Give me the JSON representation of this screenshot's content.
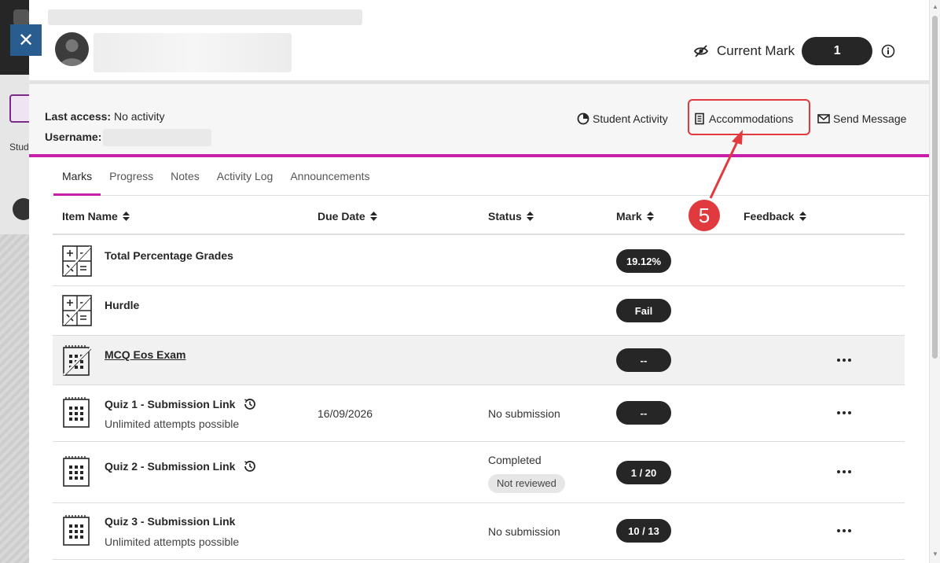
{
  "background": {
    "student_abbrev": "Stud"
  },
  "header": {
    "current_mark_label": "Current Mark",
    "current_mark_value": "1"
  },
  "meta": {
    "last_access_label": "Last access:",
    "last_access_value": "No activity",
    "username_label": "Username:"
  },
  "actions": {
    "student_activity": "Student Activity",
    "accommodations": "Accommodations",
    "send_message": "Send Message"
  },
  "tabs": [
    "Marks",
    "Progress",
    "Notes",
    "Activity Log",
    "Announcements"
  ],
  "columns": {
    "item_name": "Item Name",
    "due_date": "Due Date",
    "status": "Status",
    "mark": "Mark",
    "feedback": "Feedback"
  },
  "rows": [
    {
      "name": "Total Percentage Grades",
      "mark": "19.12%"
    },
    {
      "name": "Hurdle",
      "mark": "Fail"
    },
    {
      "name": "MCQ Eos Exam",
      "mark": "--"
    },
    {
      "name": "Quiz 1 - Submission Link",
      "sub": "Unlimited attempts possible",
      "due": "16/09/2026",
      "status": "No submission",
      "mark": "--"
    },
    {
      "name": "Quiz 2 - Submission Link",
      "status": "Completed",
      "status_badge": "Not reviewed",
      "mark": "1 / 20"
    },
    {
      "name": "Quiz 3 - Submission Link",
      "sub": "Unlimited attempts possible",
      "status": "No submission",
      "mark": "10 / 13"
    }
  ],
  "callout": {
    "number": "5",
    "color": "#e0393e"
  },
  "colors": {
    "accent": "#c71fa8",
    "dark": "#262626",
    "close": "#2a5d8f"
  }
}
